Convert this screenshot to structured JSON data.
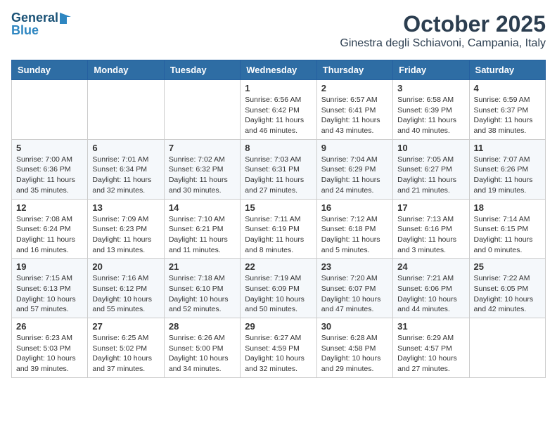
{
  "header": {
    "logo_line1": "General",
    "logo_line2": "Blue",
    "month": "October 2025",
    "location": "Ginestra degli Schiavoni, Campania, Italy"
  },
  "weekdays": [
    "Sunday",
    "Monday",
    "Tuesday",
    "Wednesday",
    "Thursday",
    "Friday",
    "Saturday"
  ],
  "weeks": [
    [
      {
        "day": "",
        "info": ""
      },
      {
        "day": "",
        "info": ""
      },
      {
        "day": "",
        "info": ""
      },
      {
        "day": "1",
        "info": "Sunrise: 6:56 AM\nSunset: 6:42 PM\nDaylight: 11 hours\nand 46 minutes."
      },
      {
        "day": "2",
        "info": "Sunrise: 6:57 AM\nSunset: 6:41 PM\nDaylight: 11 hours\nand 43 minutes."
      },
      {
        "day": "3",
        "info": "Sunrise: 6:58 AM\nSunset: 6:39 PM\nDaylight: 11 hours\nand 40 minutes."
      },
      {
        "day": "4",
        "info": "Sunrise: 6:59 AM\nSunset: 6:37 PM\nDaylight: 11 hours\nand 38 minutes."
      }
    ],
    [
      {
        "day": "5",
        "info": "Sunrise: 7:00 AM\nSunset: 6:36 PM\nDaylight: 11 hours\nand 35 minutes."
      },
      {
        "day": "6",
        "info": "Sunrise: 7:01 AM\nSunset: 6:34 PM\nDaylight: 11 hours\nand 32 minutes."
      },
      {
        "day": "7",
        "info": "Sunrise: 7:02 AM\nSunset: 6:32 PM\nDaylight: 11 hours\nand 30 minutes."
      },
      {
        "day": "8",
        "info": "Sunrise: 7:03 AM\nSunset: 6:31 PM\nDaylight: 11 hours\nand 27 minutes."
      },
      {
        "day": "9",
        "info": "Sunrise: 7:04 AM\nSunset: 6:29 PM\nDaylight: 11 hours\nand 24 minutes."
      },
      {
        "day": "10",
        "info": "Sunrise: 7:05 AM\nSunset: 6:27 PM\nDaylight: 11 hours\nand 21 minutes."
      },
      {
        "day": "11",
        "info": "Sunrise: 7:07 AM\nSunset: 6:26 PM\nDaylight: 11 hours\nand 19 minutes."
      }
    ],
    [
      {
        "day": "12",
        "info": "Sunrise: 7:08 AM\nSunset: 6:24 PM\nDaylight: 11 hours\nand 16 minutes."
      },
      {
        "day": "13",
        "info": "Sunrise: 7:09 AM\nSunset: 6:23 PM\nDaylight: 11 hours\nand 13 minutes."
      },
      {
        "day": "14",
        "info": "Sunrise: 7:10 AM\nSunset: 6:21 PM\nDaylight: 11 hours\nand 11 minutes."
      },
      {
        "day": "15",
        "info": "Sunrise: 7:11 AM\nSunset: 6:19 PM\nDaylight: 11 hours\nand 8 minutes."
      },
      {
        "day": "16",
        "info": "Sunrise: 7:12 AM\nSunset: 6:18 PM\nDaylight: 11 hours\nand 5 minutes."
      },
      {
        "day": "17",
        "info": "Sunrise: 7:13 AM\nSunset: 6:16 PM\nDaylight: 11 hours\nand 3 minutes."
      },
      {
        "day": "18",
        "info": "Sunrise: 7:14 AM\nSunset: 6:15 PM\nDaylight: 11 hours\nand 0 minutes."
      }
    ],
    [
      {
        "day": "19",
        "info": "Sunrise: 7:15 AM\nSunset: 6:13 PM\nDaylight: 10 hours\nand 57 minutes."
      },
      {
        "day": "20",
        "info": "Sunrise: 7:16 AM\nSunset: 6:12 PM\nDaylight: 10 hours\nand 55 minutes."
      },
      {
        "day": "21",
        "info": "Sunrise: 7:18 AM\nSunset: 6:10 PM\nDaylight: 10 hours\nand 52 minutes."
      },
      {
        "day": "22",
        "info": "Sunrise: 7:19 AM\nSunset: 6:09 PM\nDaylight: 10 hours\nand 50 minutes."
      },
      {
        "day": "23",
        "info": "Sunrise: 7:20 AM\nSunset: 6:07 PM\nDaylight: 10 hours\nand 47 minutes."
      },
      {
        "day": "24",
        "info": "Sunrise: 7:21 AM\nSunset: 6:06 PM\nDaylight: 10 hours\nand 44 minutes."
      },
      {
        "day": "25",
        "info": "Sunrise: 7:22 AM\nSunset: 6:05 PM\nDaylight: 10 hours\nand 42 minutes."
      }
    ],
    [
      {
        "day": "26",
        "info": "Sunrise: 6:23 AM\nSunset: 5:03 PM\nDaylight: 10 hours\nand 39 minutes."
      },
      {
        "day": "27",
        "info": "Sunrise: 6:25 AM\nSunset: 5:02 PM\nDaylight: 10 hours\nand 37 minutes."
      },
      {
        "day": "28",
        "info": "Sunrise: 6:26 AM\nSunset: 5:00 PM\nDaylight: 10 hours\nand 34 minutes."
      },
      {
        "day": "29",
        "info": "Sunrise: 6:27 AM\nSunset: 4:59 PM\nDaylight: 10 hours\nand 32 minutes."
      },
      {
        "day": "30",
        "info": "Sunrise: 6:28 AM\nSunset: 4:58 PM\nDaylight: 10 hours\nand 29 minutes."
      },
      {
        "day": "31",
        "info": "Sunrise: 6:29 AM\nSunset: 4:57 PM\nDaylight: 10 hours\nand 27 minutes."
      },
      {
        "day": "",
        "info": ""
      }
    ]
  ]
}
